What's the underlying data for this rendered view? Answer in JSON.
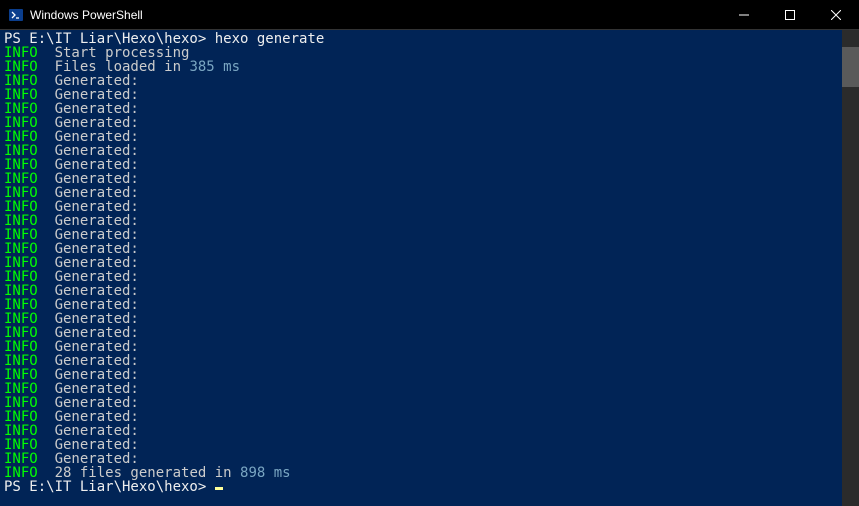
{
  "window": {
    "title": "Windows PowerShell"
  },
  "terminal": {
    "prompt1_prefix": "PS ",
    "prompt1_path": "E:\\IT Liar\\Hexo\\hexo",
    "prompt1_sep": "> ",
    "command": "hexo generate",
    "info_label": "INFO",
    "line_start_processing": "Start processing",
    "line_files_loaded_prefix": "Files loaded in ",
    "line_files_loaded_time": "385 ms",
    "generated_label": "Generated:",
    "generated_count": 28,
    "summary_prefix": "28 files generated in ",
    "summary_time": "898 ms",
    "prompt2_prefix": "PS ",
    "prompt2_path": "E:\\IT Liar\\Hexo\\hexo",
    "prompt2_sep": "> "
  }
}
